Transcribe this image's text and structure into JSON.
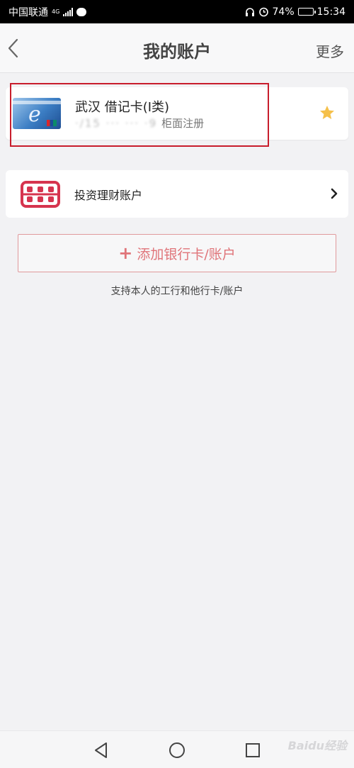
{
  "status_bar": {
    "carrier": "中国联通",
    "network": "4G",
    "battery": "74%",
    "battery_level": 0.74,
    "time": "15:34"
  },
  "header": {
    "title": "我的账户",
    "more_label": "更多"
  },
  "card": {
    "name": "武汉 借记卡(I类)",
    "masked_number": "·/15 ··· ··· ·9",
    "registration": "柜面注册",
    "thumb_text": "e"
  },
  "investment": {
    "label": "投资理财账户"
  },
  "add_account": {
    "label": "添加银行卡/账户",
    "hint": "支持本人的工行和他行卡/账户"
  },
  "watermark": "Baidu经验",
  "colors": {
    "accent": "#d6344e",
    "add_button_text": "#e07479",
    "star": "#f5c04a",
    "highlight": "#c81d2c"
  }
}
